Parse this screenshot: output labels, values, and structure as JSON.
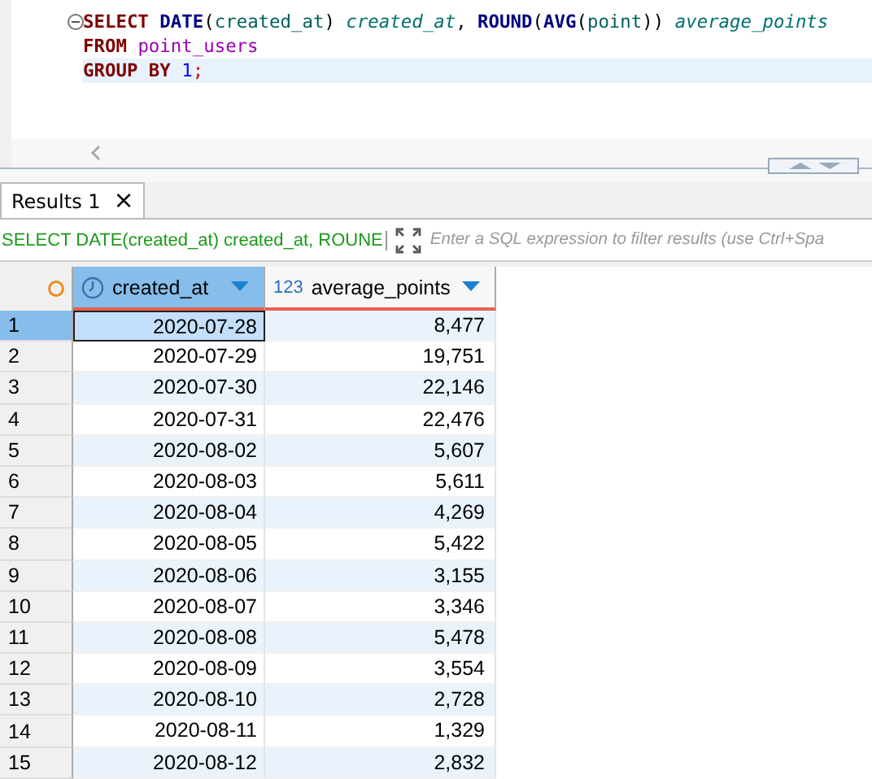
{
  "editor": {
    "lines": [
      {
        "tokens": [
          {
            "text": "SELECT",
            "kind": "keyword"
          },
          {
            "text": " DATE",
            "kind": "function"
          },
          {
            "text": "(",
            "kind": "plain"
          },
          {
            "text": "created_at",
            "kind": "ident"
          },
          {
            "text": ") ",
            "kind": "plain"
          },
          {
            "text": "created_at",
            "kind": "alias"
          },
          {
            "text": ", ",
            "kind": "plain"
          },
          {
            "text": "ROUND",
            "kind": "function"
          },
          {
            "text": "(",
            "kind": "plain"
          },
          {
            "text": "AVG",
            "kind": "function"
          },
          {
            "text": "(",
            "kind": "plain"
          },
          {
            "text": "point",
            "kind": "ident"
          },
          {
            "text": ")) ",
            "kind": "plain"
          },
          {
            "text": "average_points",
            "kind": "alias"
          }
        ],
        "current": false
      },
      {
        "tokens": [
          {
            "text": "FROM",
            "kind": "keyword"
          },
          {
            "text": " point_users",
            "kind": "table"
          }
        ],
        "current": false
      },
      {
        "tokens": [
          {
            "text": "GROUP BY",
            "kind": "keyword"
          },
          {
            "text": " 1",
            "kind": "number"
          },
          {
            "text": ";",
            "kind": "punct"
          }
        ],
        "current": true
      }
    ]
  },
  "results_tab": {
    "label": "Results 1",
    "close": "×"
  },
  "filter_bar": {
    "query": "SELECT DATE(created_at) created_at, ROUNE",
    "placeholder": "Enter a SQL expression to filter results (use Ctrl+Spa"
  },
  "table": {
    "columns": [
      {
        "label": "created_at",
        "kind": "date",
        "selected": true
      },
      {
        "label": "average_points",
        "type_label": "123",
        "kind": "number",
        "selected": false
      }
    ],
    "rows": [
      {
        "n": "1",
        "cells": [
          "2020-07-28",
          "8,477"
        ],
        "selected": true
      },
      {
        "n": "2",
        "cells": [
          "2020-07-29",
          "19,751"
        ],
        "selected": false
      },
      {
        "n": "3",
        "cells": [
          "2020-07-30",
          "22,146"
        ],
        "selected": false
      },
      {
        "n": "4",
        "cells": [
          "2020-07-31",
          "22,476"
        ],
        "selected": false
      },
      {
        "n": "5",
        "cells": [
          "2020-08-02",
          "5,607"
        ],
        "selected": false
      },
      {
        "n": "6",
        "cells": [
          "2020-08-03",
          "5,611"
        ],
        "selected": false
      },
      {
        "n": "7",
        "cells": [
          "2020-08-04",
          "4,269"
        ],
        "selected": false
      },
      {
        "n": "8",
        "cells": [
          "2020-08-05",
          "5,422"
        ],
        "selected": false
      },
      {
        "n": "9",
        "cells": [
          "2020-08-06",
          "3,155"
        ],
        "selected": false
      },
      {
        "n": "10",
        "cells": [
          "2020-08-07",
          "3,346"
        ],
        "selected": false
      },
      {
        "n": "11",
        "cells": [
          "2020-08-08",
          "5,478"
        ],
        "selected": false
      },
      {
        "n": "12",
        "cells": [
          "2020-08-09",
          "3,554"
        ],
        "selected": false
      },
      {
        "n": "13",
        "cells": [
          "2020-08-10",
          "2,728"
        ],
        "selected": false
      },
      {
        "n": "14",
        "cells": [
          "2020-08-11",
          "1,329"
        ],
        "selected": false
      },
      {
        "n": "15",
        "cells": [
          "2020-08-12",
          "2,832"
        ],
        "selected": false
      }
    ]
  }
}
